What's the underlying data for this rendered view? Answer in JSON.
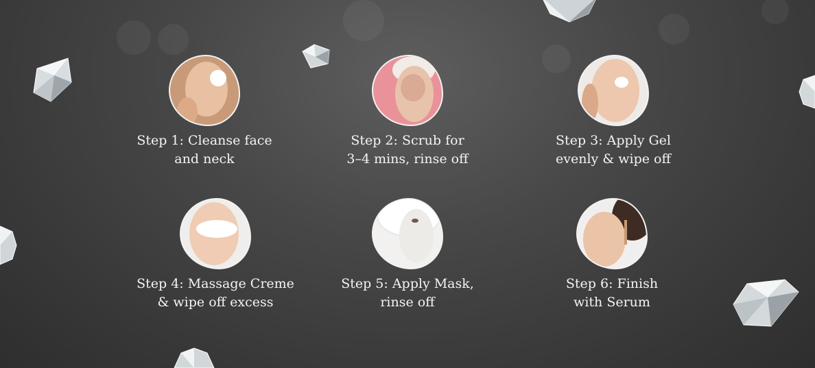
{
  "steps": [
    {
      "label": "Step 1: Cleanse face\nand neck",
      "icon": "face-cleansing-photo"
    },
    {
      "label": "Step 2: Scrub for\n3–4 mins, rinse off",
      "icon": "face-scrub-photo"
    },
    {
      "label": "Step 3: Apply Gel\nevenly & wipe off",
      "icon": "face-gel-photo"
    },
    {
      "label": "Step 4: Massage Creme\n& wipe off excess",
      "icon": "face-creme-photo"
    },
    {
      "label": "Step 5: Apply Mask,\nrinse off",
      "icon": "face-mask-photo"
    },
    {
      "label": "Step 6: Finish\nwith Serum",
      "icon": "face-serum-photo"
    }
  ],
  "colors": {
    "background": "#444444",
    "text": "#f4f4f4",
    "blob_border": "#f2f2f2"
  }
}
